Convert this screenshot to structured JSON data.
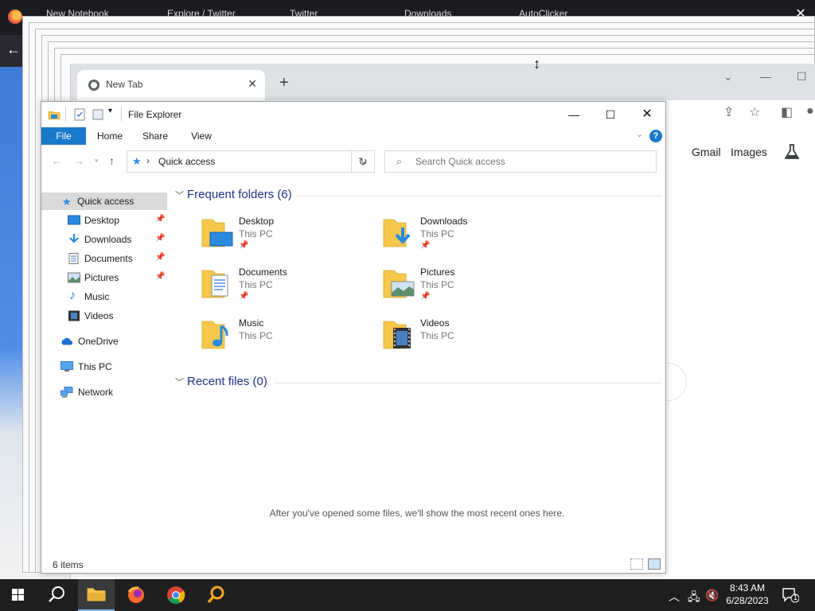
{
  "background_browser": {
    "tabs": [
      "New Notebook",
      "Explore / Twitter",
      "Twitter",
      "Downloads",
      "AutoClicker"
    ]
  },
  "chrome": {
    "tab_title": "New Tab",
    "links": [
      "Gmail",
      "Images"
    ]
  },
  "explorer": {
    "title": "File Explorer",
    "ribbon_tabs": [
      "File",
      "Home",
      "Share",
      "View"
    ],
    "help": "?",
    "address": "Quick access",
    "search_placeholder": "Search Quick access",
    "nav": {
      "quick_access": "Quick access",
      "desktop": "Desktop",
      "downloads": "Downloads",
      "documents": "Documents",
      "pictures": "Pictures",
      "music": "Music",
      "videos": "Videos",
      "onedrive": "OneDrive",
      "this_pc": "This PC",
      "network": "Network"
    },
    "frequent_header": "Frequent folders (6)",
    "folders": [
      {
        "name": "Desktop",
        "location": "This PC"
      },
      {
        "name": "Downloads",
        "location": "This PC"
      },
      {
        "name": "Documents",
        "location": "This PC"
      },
      {
        "name": "Pictures",
        "location": "This PC"
      },
      {
        "name": "Music",
        "location": "This PC"
      },
      {
        "name": "Videos",
        "location": "This PC"
      }
    ],
    "recent_header": "Recent files (0)",
    "recent_empty": "After you've opened some files, we'll show the most recent ones here.",
    "status": "6 items"
  },
  "taskbar": {
    "time": "8:43 AM",
    "date": "6/28/2023",
    "notification_count": "1"
  },
  "colors": {
    "ribbon_file": "#1979ca",
    "section_header": "#1e3287",
    "folder_yellow": "#f5c84c",
    "taskbar": "#1f1f1f"
  }
}
